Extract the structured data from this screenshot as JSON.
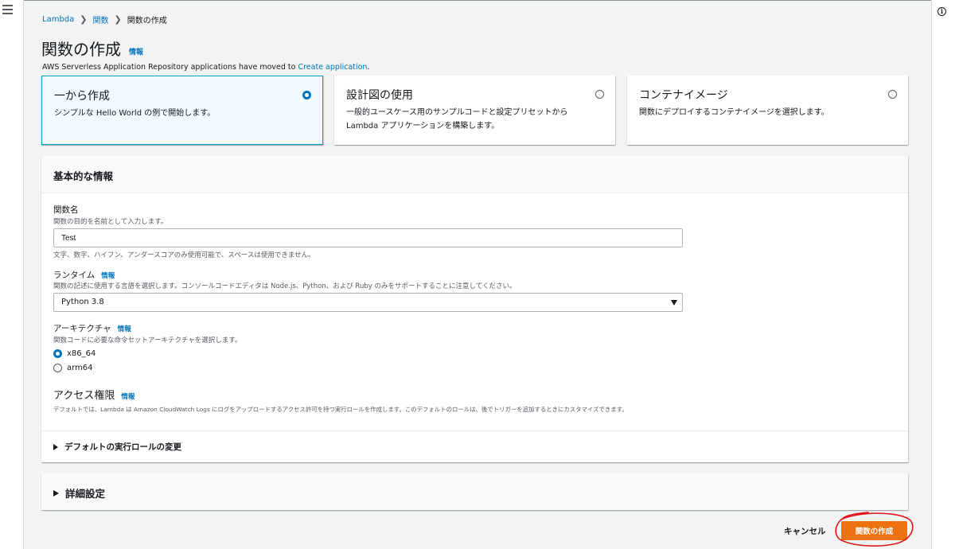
{
  "breadcrumb": {
    "items": [
      "Lambda",
      "関数",
      "関数の作成"
    ],
    "separator": "❯"
  },
  "page": {
    "title": "関数の作成",
    "info_label": "情報",
    "notice_text": "AWS Serverless Application Repository applications have moved to ",
    "notice_link": "Create application",
    "notice_tail": "."
  },
  "options": [
    {
      "title": "一から作成",
      "desc": "シンプルな Hello World の例で開始します。",
      "selected": true
    },
    {
      "title": "設計図の使用",
      "desc": "一般的ユースケース用のサンプルコードと設定プリセットから Lambda アプリケーションを構築します。",
      "selected": false
    },
    {
      "title": "コンテナイメージ",
      "desc": "関数にデプロイするコンテナイメージを選択します。",
      "selected": false
    }
  ],
  "basic": {
    "title": "基本的な情報",
    "function_name": {
      "label": "関数名",
      "desc": "関数の目的を名前として入力します。",
      "value": "Test",
      "hint": "文字、数字、ハイフン、アンダースコアのみ使用可能で、スペースは使用できません。"
    },
    "runtime": {
      "label": "ランタイム",
      "info": "情報",
      "desc": "関数の記述に使用する言語を選択します。コンソールコードエディタは Node.js、Python、および Ruby のみをサポートすることに注意してください。",
      "value": "Python 3.8"
    },
    "architecture": {
      "label": "アーキテクチャ",
      "info": "情報",
      "desc": "関数コードに必要な命令セットアーキテクチャを選択します。",
      "options": [
        "x86_64",
        "arm64"
      ],
      "selected": "x86_64"
    },
    "permissions": {
      "title": "アクセス権限",
      "info": "情報",
      "desc": "デフォルトでは、Lambda は Amazon CloudWatch Logs にログをアップロードするアクセス許可を持つ実行ロールを作成します。このデフォルトのロールは、後でトリガーを追加するときにカスタマイズできます。",
      "expander": "デフォルトの実行ロールの変更"
    }
  },
  "advanced": {
    "title": "詳細設定"
  },
  "footer": {
    "cancel_label": "キャンセル",
    "create_label": "関数の作成"
  },
  "colors": {
    "accent": "#0073bb",
    "primary_button": "#ec7211",
    "highlight_annotation": "#e0131a"
  }
}
